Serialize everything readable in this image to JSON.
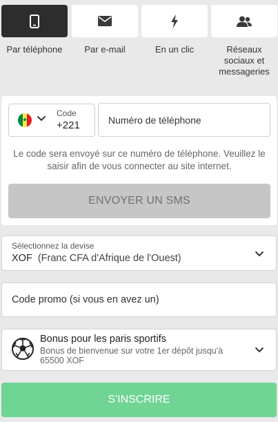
{
  "tabs": [
    {
      "label": "Par téléphone",
      "icon": "smartphone-icon",
      "active": true
    },
    {
      "label": "Par e-mail",
      "icon": "envelope-icon",
      "active": false
    },
    {
      "label": "En un clic",
      "icon": "lightning-icon",
      "active": false
    },
    {
      "label": "Réseaux sociaux et messageries",
      "icon": "users-icon",
      "active": false
    }
  ],
  "phone_form": {
    "country_flag": "senegal-flag-icon",
    "code_label": "Code",
    "code_value": "+221",
    "phone_placeholder": "Numéro de téléphone",
    "hint": "Le code sera envoyé sur ce numéro de téléphone. Veuillez le saisir afin de vous connecter au site internet.",
    "send_sms_label": "ENVOYER UN SMS"
  },
  "currency": {
    "label": "Sélectionnez la devise",
    "code": "XOF",
    "name": "(Franc CFA d'Afrique de l'Ouest)"
  },
  "promo": {
    "placeholder": "Code promo (si vous en avez un)"
  },
  "bonus": {
    "title": "Bonus pour les paris sportifs",
    "description": "Bonus de bienvenue sur votre 1er dépôt jusqu'à 65500 XOF"
  },
  "submit_label": "S'INSCRIRE",
  "colors": {
    "background": "#e9e9e9",
    "active_tab": "#2d2d2d",
    "disabled_button": "#c6c6c6",
    "submit_button": "#6fd494"
  }
}
